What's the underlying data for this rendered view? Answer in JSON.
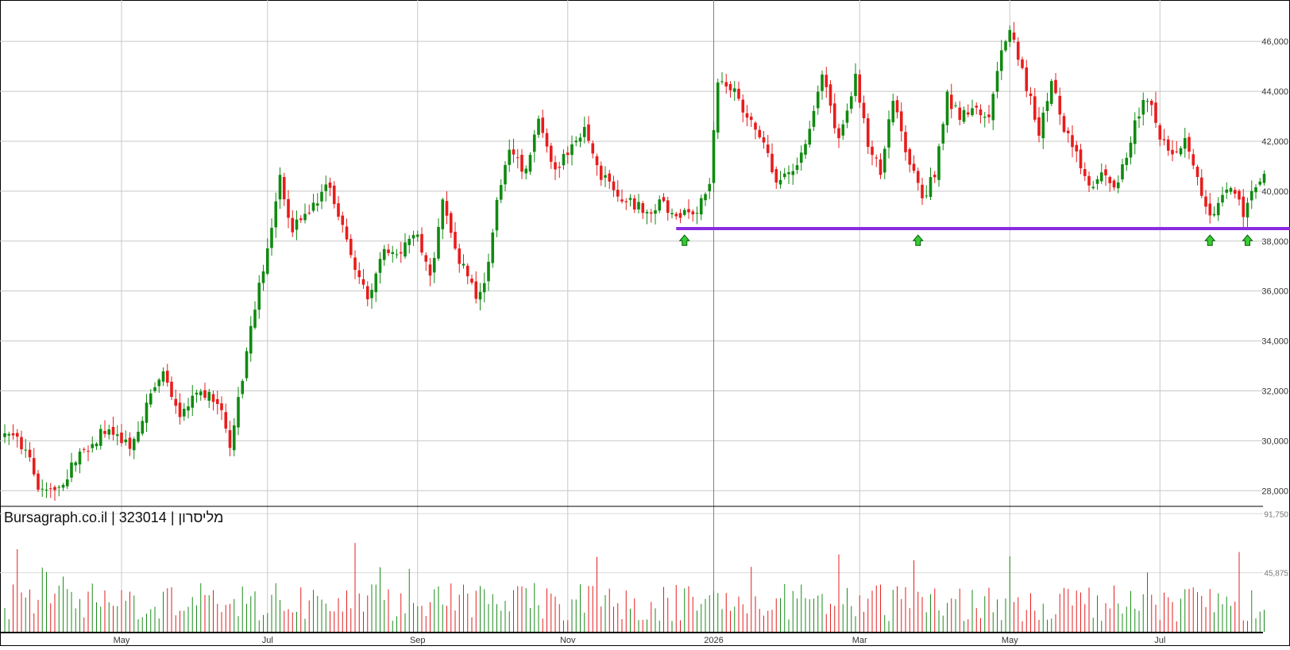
{
  "chart_data": {
    "type": "candlestick",
    "watermark": "Bursagraph.co.il | 323014 | מליסרון",
    "price_axis": {
      "ylim": [
        27500,
        47500
      ],
      "ticks": [
        28000,
        30000,
        32000,
        34000,
        36000,
        38000,
        40000,
        42000,
        44000,
        46000
      ],
      "tick_labels": [
        "28,000",
        "30,000",
        "32,000",
        "34,000",
        "36,000",
        "38,000",
        "40,000",
        "42,000",
        "44,000",
        "46,000"
      ]
    },
    "volume_axis": {
      "ylim": [
        0,
        95000
      ],
      "ticks": [
        45875,
        91750
      ],
      "tick_labels": [
        "45,875",
        "91,750"
      ]
    },
    "x_axis": {
      "months": [
        "May",
        "Jul",
        "Sep",
        "Nov",
        "2026",
        "Mar",
        "May",
        "Jul"
      ],
      "month_bar_index": [
        28,
        63,
        99,
        135,
        170,
        205,
        241,
        277
      ]
    },
    "support_line": {
      "value": 38500,
      "start_index": 161,
      "end_index": 309,
      "color": "#8a2be2"
    },
    "markers": {
      "type": "arrow-up",
      "color": "#33cc33",
      "indices": [
        163,
        219,
        289,
        298
      ],
      "value": 38050
    },
    "anchor_points": [
      [
        0,
        30200
      ],
      [
        5,
        29800
      ],
      [
        8,
        28100
      ],
      [
        12,
        27900
      ],
      [
        18,
        29500
      ],
      [
        24,
        30400
      ],
      [
        30,
        29900
      ],
      [
        38,
        32700
      ],
      [
        42,
        31000
      ],
      [
        47,
        32000
      ],
      [
        52,
        31300
      ],
      [
        54,
        29700
      ],
      [
        58,
        33500
      ],
      [
        62,
        37000
      ],
      [
        66,
        40500
      ],
      [
        69,
        38500
      ],
      [
        74,
        39500
      ],
      [
        78,
        40200
      ],
      [
        81,
        38600
      ],
      [
        84,
        37000
      ],
      [
        87,
        35700
      ],
      [
        91,
        37800
      ],
      [
        94,
        37400
      ],
      [
        99,
        38400
      ],
      [
        102,
        36500
      ],
      [
        105,
        39500
      ],
      [
        108,
        37500
      ],
      [
        111,
        36800
      ],
      [
        113,
        35600
      ],
      [
        116,
        37000
      ],
      [
        118,
        39700
      ],
      [
        121,
        41900
      ],
      [
        125,
        40700
      ],
      [
        128,
        43000
      ],
      [
        132,
        40800
      ],
      [
        135,
        41500
      ],
      [
        139,
        42600
      ],
      [
        143,
        40600
      ],
      [
        148,
        39800
      ],
      [
        154,
        39200
      ],
      [
        158,
        39500
      ],
      [
        162,
        39000
      ],
      [
        166,
        39200
      ],
      [
        169,
        40500
      ],
      [
        171,
        44500
      ],
      [
        175,
        44200
      ],
      [
        178,
        43000
      ],
      [
        181,
        42400
      ],
      [
        185,
        40400
      ],
      [
        189,
        40800
      ],
      [
        193,
        42300
      ],
      [
        196,
        44800
      ],
      [
        200,
        42100
      ],
      [
        204,
        44500
      ],
      [
        207,
        42000
      ],
      [
        210,
        40800
      ],
      [
        213,
        43800
      ],
      [
        216,
        41500
      ],
      [
        220,
        39800
      ],
      [
        223,
        40600
      ],
      [
        226,
        43800
      ],
      [
        229,
        43000
      ],
      [
        232,
        43400
      ],
      [
        236,
        42800
      ],
      [
        239,
        45500
      ],
      [
        241,
        46600
      ],
      [
        243,
        45500
      ],
      [
        246,
        43600
      ],
      [
        248,
        42200
      ],
      [
        251,
        44600
      ],
      [
        254,
        42400
      ],
      [
        257,
        41600
      ],
      [
        260,
        40300
      ],
      [
        263,
        40600
      ],
      [
        266,
        40000
      ],
      [
        268,
        40900
      ],
      [
        271,
        42800
      ],
      [
        274,
        43800
      ],
      [
        277,
        42200
      ],
      [
        280,
        41300
      ],
      [
        283,
        41900
      ],
      [
        286,
        40400
      ],
      [
        289,
        39000
      ],
      [
        292,
        39900
      ],
      [
        295,
        40100
      ],
      [
        297,
        38900
      ],
      [
        300,
        40300
      ],
      [
        302,
        40600
      ]
    ]
  }
}
